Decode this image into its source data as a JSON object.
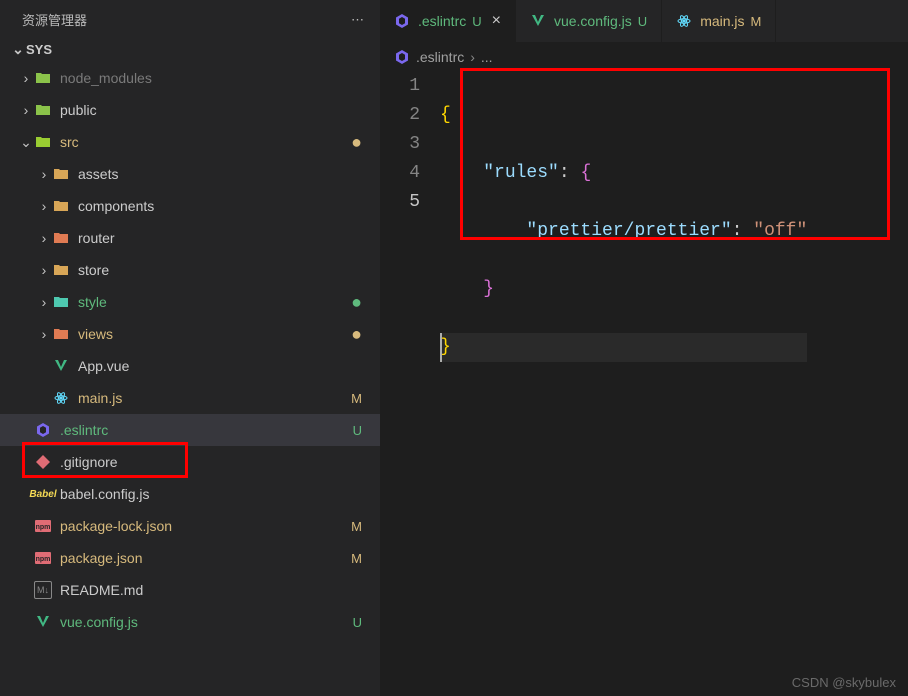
{
  "sidebar": {
    "title": "资源管理器",
    "root": "SYS",
    "items": [
      {
        "label": "node_modules",
        "status": "",
        "class": "name-ignored"
      },
      {
        "label": "public",
        "status": "",
        "class": "name-dim"
      },
      {
        "label": "src",
        "status": "dot-yellow",
        "class": "name-modified"
      },
      {
        "label": "assets",
        "status": "",
        "class": "name-dim"
      },
      {
        "label": "components",
        "status": "",
        "class": "name-dim"
      },
      {
        "label": "router",
        "status": "",
        "class": "name-dim"
      },
      {
        "label": "store",
        "status": "",
        "class": "name-dim"
      },
      {
        "label": "style",
        "status": "dot-green",
        "class": "name-untracked"
      },
      {
        "label": "views",
        "status": "dot-yellow",
        "class": "name-modified"
      },
      {
        "label": "App.vue",
        "status": "",
        "class": "name-dim"
      },
      {
        "label": "main.js",
        "status": "M",
        "class": "name-modified"
      },
      {
        "label": ".eslintrc",
        "status": "U",
        "class": "name-untracked"
      },
      {
        "label": ".gitignore",
        "status": "",
        "class": "name-dim"
      },
      {
        "label": "babel.config.js",
        "status": "",
        "class": "name-dim"
      },
      {
        "label": "package-lock.json",
        "status": "M",
        "class": "name-modified"
      },
      {
        "label": "package.json",
        "status": "M",
        "class": "name-modified"
      },
      {
        "label": "README.md",
        "status": "",
        "class": "name-dim"
      },
      {
        "label": "vue.config.js",
        "status": "U",
        "class": "name-untracked"
      }
    ]
  },
  "tabs": {
    "items": [
      {
        "name": ".eslintrc",
        "status": "U",
        "active": true
      },
      {
        "name": "vue.config.js",
        "status": "U",
        "active": false
      },
      {
        "name": "main.js",
        "status": "M",
        "active": false
      }
    ],
    "close_glyph": "×"
  },
  "breadcrumb": {
    "file": ".eslintrc",
    "sep": "›",
    "more": "..."
  },
  "code": {
    "lines": [
      "1",
      "2",
      "3",
      "4",
      "5"
    ],
    "l2_key": "\"rules\"",
    "l2_colon": ": ",
    "l3_key": "\"prettier/prettier\"",
    "l3_colon": ": ",
    "l3_val": "\"off\""
  },
  "watermark": "CSDN @skybulex"
}
